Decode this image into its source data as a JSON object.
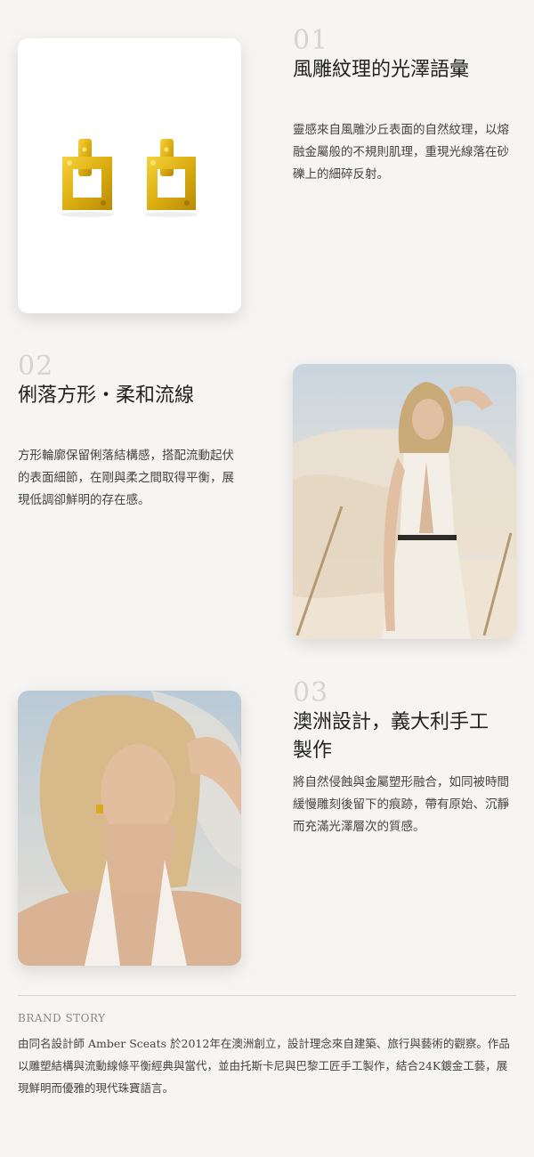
{
  "sections": [
    {
      "number": "01",
      "title": "風雕紋理的光澤語彙",
      "description": "靈感來自風雕沙丘表面的自然紋理，以熔融金屬般的不規則肌理，重現光線落在砂礫上的細碎反射。"
    },
    {
      "number": "02",
      "title": "俐落方形・柔和流線",
      "description": "方形輪廓保留俐落結構感，搭配流動起伏的表面細節，在剛與柔之間取得平衡，展現低調卻鮮明的存在感。"
    },
    {
      "number": "03",
      "title_line1": "澳洲設計，義大利手工",
      "title_line2": "製作",
      "description": "將自然侵蝕與金屬塑形融合，如同被時間緩慢雕刻後留下的痕跡，帶有原始、沉靜而充滿光澤層次的質感。"
    }
  ],
  "brand": {
    "label": "BRAND STORY",
    "text": "由同名設計師 Amber Sceats 於2012年在澳洲創立，設計理念來自建築、旅行與藝術的觀察。作品以雕塑結構與流動線條平衡經典與當代，並由托斯卡尼與巴黎工匠手工製作，結合24K鍍金工藝，展現鮮明而優雅的現代珠寶語言。"
  },
  "colors": {
    "background": "#f6f5f3",
    "gold": "#e2b61b",
    "number": "#d6d4cf"
  }
}
